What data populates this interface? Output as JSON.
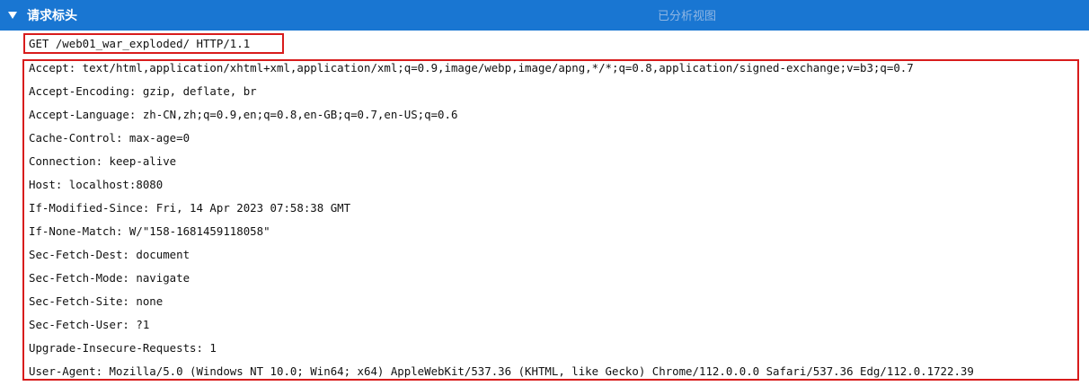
{
  "panel": {
    "title": "请求标头",
    "view_link": "已分析视图",
    "collapse_icon": "triangle-down-icon",
    "colors": {
      "header_bg": "#1976d2",
      "highlight_border": "#d81c1c"
    }
  },
  "request_line": "GET /web01_war_exploded/ HTTP/1.1",
  "headers": [
    "Accept: text/html,application/xhtml+xml,application/xml;q=0.9,image/webp,image/apng,*/*;q=0.8,application/signed-exchange;v=b3;q=0.7",
    "Accept-Encoding: gzip, deflate, br",
    "Accept-Language: zh-CN,zh;q=0.9,en;q=0.8,en-GB;q=0.7,en-US;q=0.6",
    "Cache-Control: max-age=0",
    "Connection: keep-alive",
    "Host: localhost:8080",
    "If-Modified-Since: Fri, 14 Apr 2023 07:58:38 GMT",
    "If-None-Match: W/\"158-1681459118058\"",
    "Sec-Fetch-Dest: document",
    "Sec-Fetch-Mode: navigate",
    "Sec-Fetch-Site: none",
    "Sec-Fetch-User: ?1",
    "Upgrade-Insecure-Requests: 1",
    "User-Agent: Mozilla/5.0 (Windows NT 10.0; Win64; x64) AppleWebKit/537.36 (KHTML, like Gecko) Chrome/112.0.0.0 Safari/537.36 Edg/112.0.1722.39"
  ]
}
